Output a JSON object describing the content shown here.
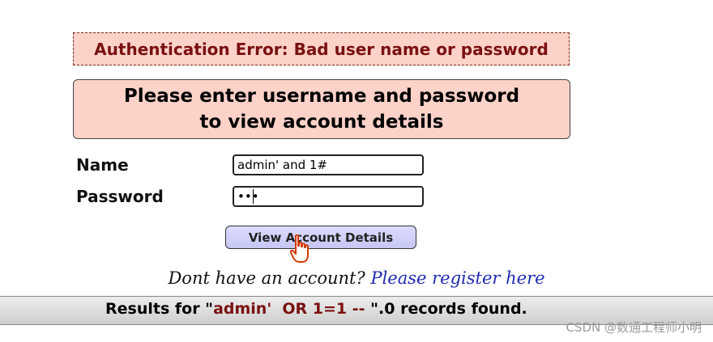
{
  "error_message": "Authentication Error: Bad user name or password",
  "prompt": {
    "line1": "Please enter username and password",
    "line2": "to view account details"
  },
  "form": {
    "name_label": "Name",
    "name_value": "admin' and 1#",
    "password_label": "Password",
    "password_value": "abc",
    "submit_label": "View Account Details"
  },
  "register": {
    "question": "Dont have an account?",
    "link": "Please register here"
  },
  "results": {
    "prefix": "Results for \"",
    "query": "admin'  OR 1=1 -- ",
    "suffix": "\".0 records found."
  },
  "watermark": "CSDN @数通工程师小明"
}
